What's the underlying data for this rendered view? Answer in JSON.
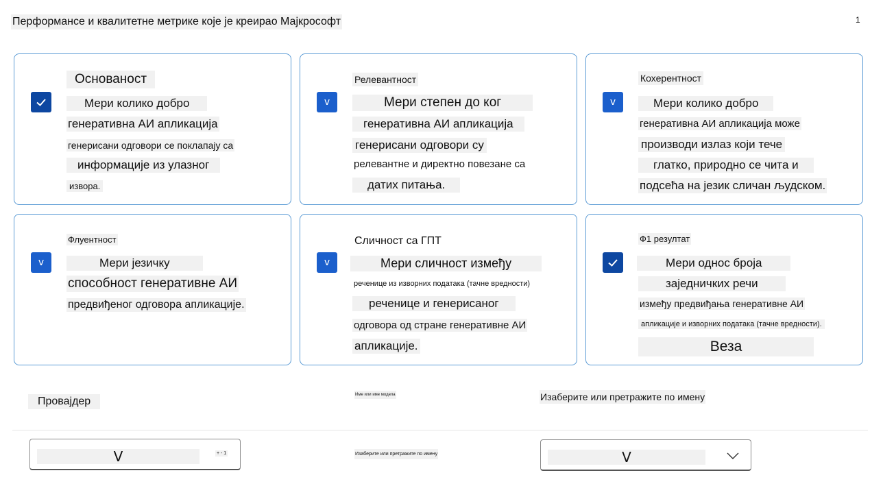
{
  "page": {
    "title": "Перформансе и квалитетне метрике које је креирао Мајкрософт",
    "page_number": "1"
  },
  "cards": [
    {
      "title": "Основаност",
      "checked_icon": "checkmark-icon",
      "lines": [
        "Мери колико добро",
        "генеративна АИ апликација",
        "генерисани одговори се поклапају са",
        "информације из улазног",
        "извора."
      ]
    },
    {
      "title": "Релевантност",
      "checked_icon": "v",
      "lines": [
        "Мери степен до ког",
        "генеративна АИ апликација",
        "генерисани одговори су",
        "релевантне и директно повезане са",
        "датих питања."
      ]
    },
    {
      "title": "Кохерентност",
      "checked_icon": "v",
      "lines": [
        "Мери колико добро",
        "генеративна АИ апликација може",
        "производи излаз који тече",
        "глатко, природно се чита и",
        "подсећа на језик сличан људском."
      ]
    },
    {
      "title": "Флуентност",
      "checked_icon": "v",
      "lines": [
        "Мери језичку",
        "способност генеративне АИ",
        "предвиђеног одговора апликације."
      ]
    },
    {
      "title": "Сличност са ГПТ",
      "checked_icon": "v",
      "lines": [
        "Мери сличност између",
        "реченице из изворних података (тачне вредности)",
        "реченице и генерисаног",
        "одговора од стране генеративне АИ",
        "апликације."
      ]
    },
    {
      "title": "Ф1 резултат",
      "checked_icon": "checkmark-icon",
      "lines": [
        "Мери однос броја",
        "заједничких речи",
        "између предвиђања генеративне АИ",
        "апликације и изворних података (тачне вредности).",
        "Веза"
      ]
    }
  ],
  "bottom": {
    "provider_label": "Провајдер",
    "tiny_label_top": "Име или име модела",
    "search_label": "Изаберите или претражите по имену",
    "tiny_label_bottom": "Изаберите или претражите по имену",
    "provider_select_value": "V",
    "provider_select_badge": "+ - 1",
    "name_select_value": "V"
  },
  "colors": {
    "accent": "#1b5fcc",
    "border": "#5b9bd5"
  }
}
